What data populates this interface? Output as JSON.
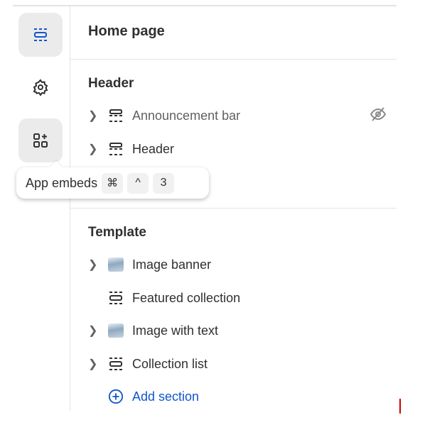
{
  "rail": {
    "items": [
      {
        "name": "sections",
        "icon": "sections-icon",
        "active": true
      },
      {
        "name": "theme-settings",
        "icon": "gear-icon"
      },
      {
        "name": "app-embeds",
        "icon": "apps-add-icon"
      }
    ]
  },
  "tooltip": {
    "label": "App embeds",
    "keys": [
      "⌘",
      "^",
      "3"
    ]
  },
  "panel": {
    "title": "Home page",
    "header_group": {
      "title": "Header",
      "items": [
        {
          "label": "Announcement bar",
          "hidden": true
        },
        {
          "label": "Header"
        }
      ]
    },
    "template_group": {
      "title": "Template",
      "items": [
        {
          "label": "Image banner"
        },
        {
          "label": "Featured collection"
        },
        {
          "label": "Image with text"
        },
        {
          "label": "Collection list"
        }
      ],
      "add_label": "Add section"
    }
  },
  "colors": {
    "accent": "#1155cc",
    "text": "#303030"
  }
}
